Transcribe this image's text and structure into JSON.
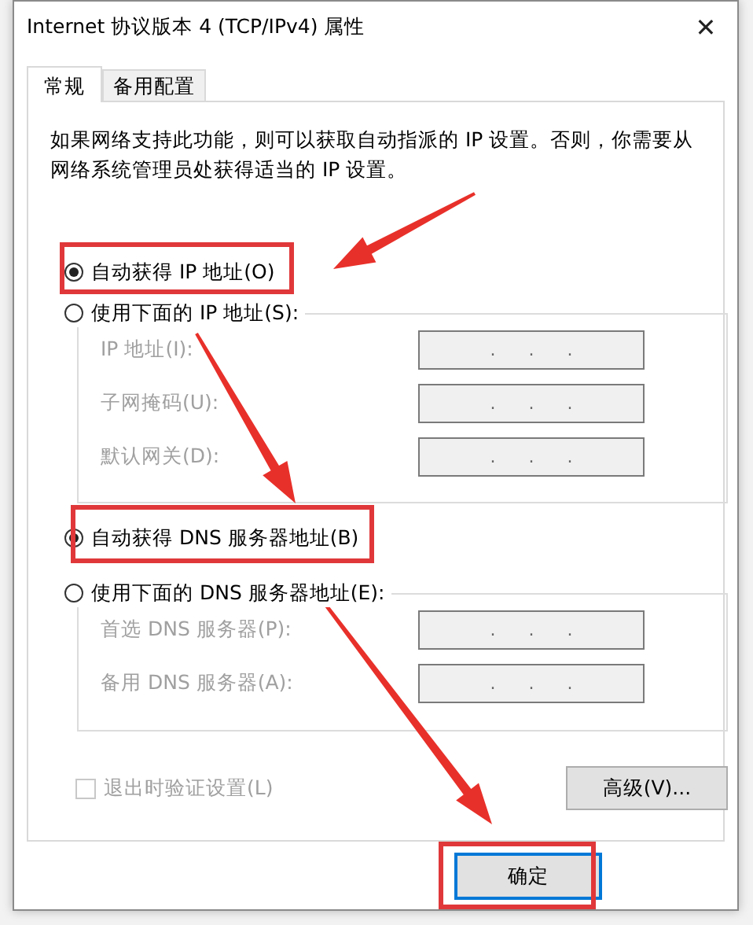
{
  "window": {
    "title": "Internet 协议版本 4 (TCP/IPv4) 属性",
    "close": "✕"
  },
  "tabs": [
    {
      "label": "常规",
      "selected": true
    },
    {
      "label": "备用配置",
      "selected": false
    }
  ],
  "description": "如果网络支持此功能，则可以获取自动指派的 IP 设置。否则，你需要从网络系统管理员处获得适当的 IP 设置。",
  "ip": {
    "auto": {
      "label": "自动获得 IP 地址(O)",
      "selected": true
    },
    "manual": {
      "label": "使用下面的 IP 地址(S):",
      "selected": false
    },
    "fields": [
      {
        "label": "IP 地址(I):",
        "value": ".      .      .",
        "disabled": true
      },
      {
        "label": "子网掩码(U):",
        "value": ".      .      .",
        "disabled": true
      },
      {
        "label": "默认网关(D):",
        "value": ".      .      .",
        "disabled": true
      }
    ]
  },
  "dns": {
    "auto": {
      "label": "自动获得 DNS 服务器地址(B)",
      "selected": true
    },
    "manual": {
      "label": "使用下面的 DNS 服务器地址(E):",
      "selected": false
    },
    "fields": [
      {
        "label": "首选 DNS 服务器(P):",
        "value": ".      .      .",
        "disabled": true
      },
      {
        "label": "备用 DNS 服务器(A):",
        "value": ".      .      .",
        "disabled": true
      }
    ]
  },
  "validate": {
    "label": "退出时验证设置(L)",
    "checked": false,
    "disabled": true
  },
  "advanced_button": "高级(V)...",
  "ok_button": "确定"
}
